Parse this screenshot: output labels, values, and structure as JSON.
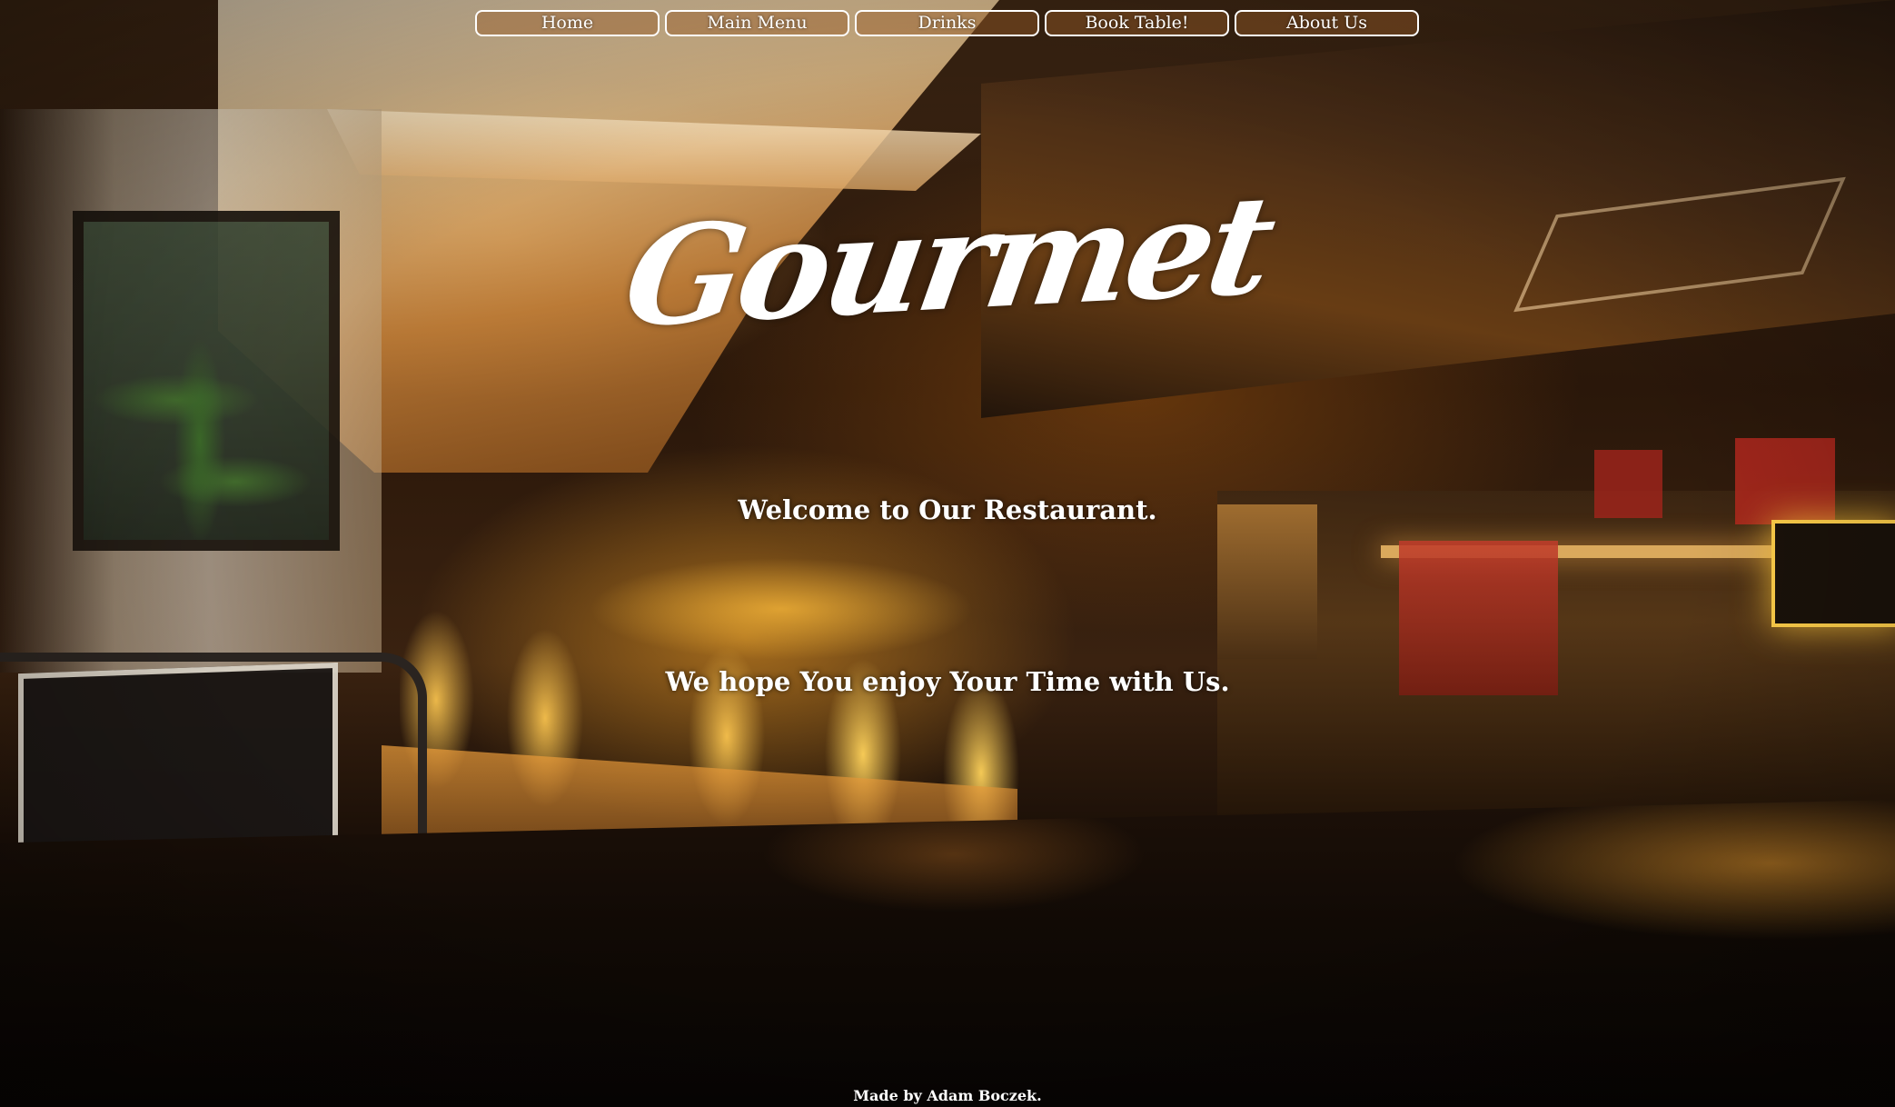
{
  "nav": {
    "items": [
      {
        "label": "Home"
      },
      {
        "label": "Main Menu"
      },
      {
        "label": "Drinks"
      },
      {
        "label": "Book Table!"
      },
      {
        "label": "About Us"
      }
    ]
  },
  "hero": {
    "brand": "Gourmet",
    "welcome": "Welcome to Our Restaurant.",
    "tagline": "We hope You enjoy Your Time with Us."
  },
  "footer": {
    "credit": "Made by Adam Boczek."
  },
  "colors": {
    "text": "#ffffff",
    "nav_border": "#ffffff",
    "background_warm": "#3a2412"
  }
}
